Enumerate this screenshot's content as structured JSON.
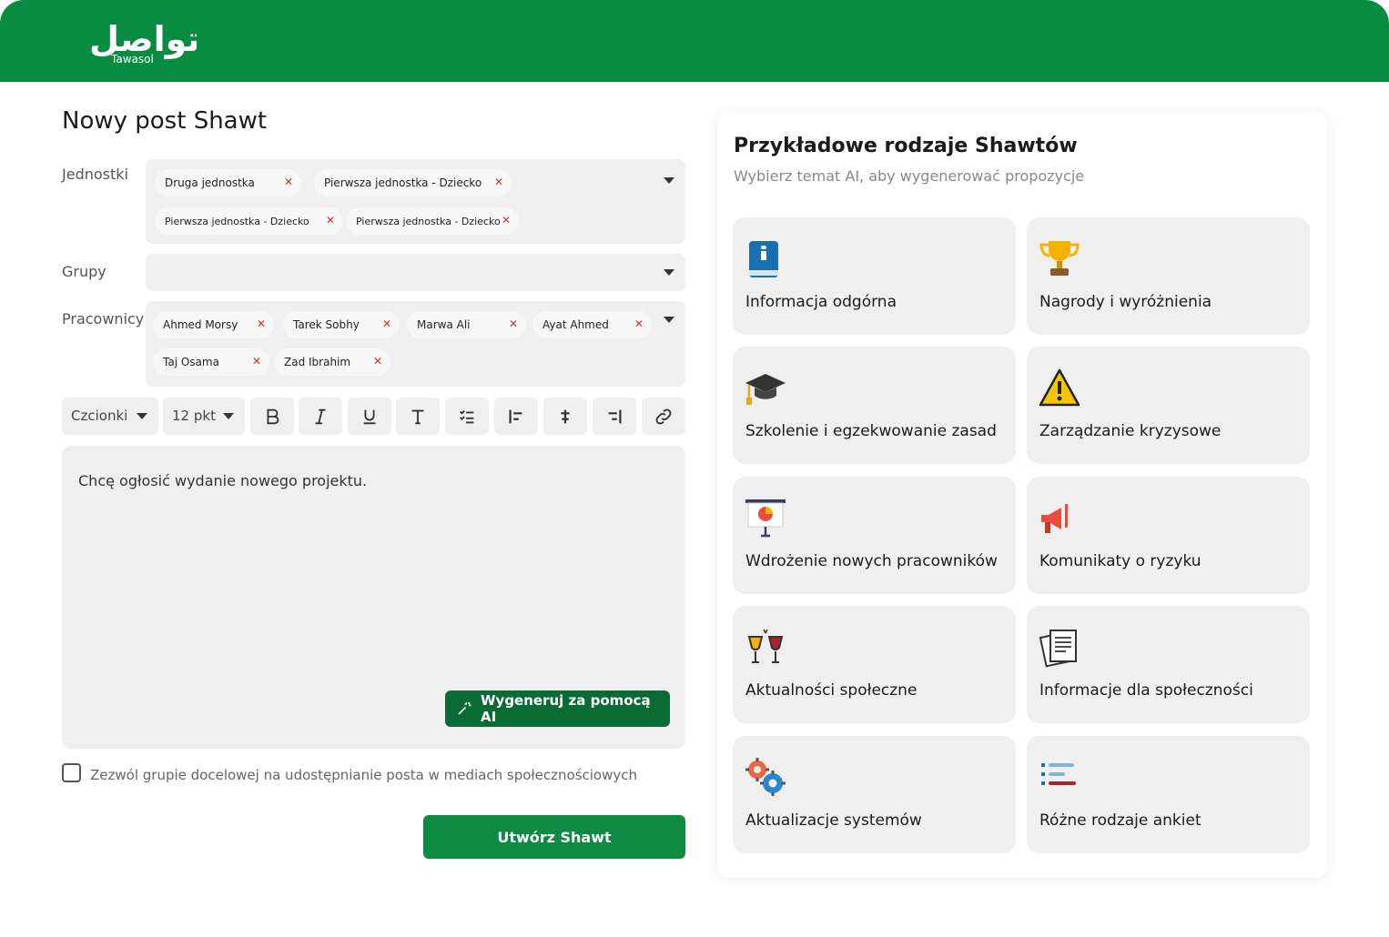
{
  "brand": {
    "logo_ar": "تواصل",
    "logo_en": "Tawasol",
    "color": "#078c42"
  },
  "page_title": "Nowy post Shawt",
  "fields": {
    "units_label": "Jednostki",
    "groups_label": "Grupy",
    "employees_label": "Pracownicy"
  },
  "units": [
    "Druga jednostka",
    "Pierwsza jednostka - Dziecko",
    "Pierwsza jednostka - Dziecko",
    "Pierwsza jednostka - Dziecko"
  ],
  "employees": [
    "Ahmed Morsy",
    "Tarek Sobhy",
    "Marwa Ali",
    "Ayat Ahmed",
    "Taj Osama",
    "Zad Ibrahim"
  ],
  "toolbar": {
    "font_label": "Czcionki",
    "size_label": "12 pkt",
    "icons": [
      "bold-icon",
      "italic-icon",
      "underline-icon",
      "text-icon",
      "checklist-icon",
      "align-left-icon",
      "align-center-icon",
      "align-right-icon",
      "link-icon"
    ]
  },
  "editor": {
    "text": "Chcę ogłosić wydanie nowego projektu.",
    "ai_button": "Wygeneruj za pomocą AI"
  },
  "share_checkbox": {
    "label": "Zezwól grupie docelowej na udostępnianie posta w mediach społecznościowych",
    "checked": false
  },
  "submit_label": "Utwórz Shawt",
  "panel": {
    "title": "Przykładowe rodzaje Shawtów",
    "subtitle": "Wybierz temat AI, aby wygenerować propozycje",
    "cards": [
      {
        "label": "Informacja odgórna",
        "icon": "info-book-icon"
      },
      {
        "label": "Nagrody i wyróżnienia",
        "icon": "trophy-icon"
      },
      {
        "label": "Szkolenie i egzekwowanie zasad",
        "icon": "graduation-cap-icon"
      },
      {
        "label": "Zarządzanie kryzysowe",
        "icon": "warning-icon"
      },
      {
        "label": "Wdrożenie nowych pracowników",
        "icon": "presentation-icon"
      },
      {
        "label": "Komunikaty o ryzyku",
        "icon": "megaphone-icon"
      },
      {
        "label": "Aktualności społeczne",
        "icon": "wine-glasses-icon"
      },
      {
        "label": "Informacje dla społeczności",
        "icon": "documents-icon"
      },
      {
        "label": "Aktualizacje systemów",
        "icon": "gears-icon"
      },
      {
        "label": "Różne rodzaje ankiet",
        "icon": "poll-icon"
      }
    ]
  }
}
